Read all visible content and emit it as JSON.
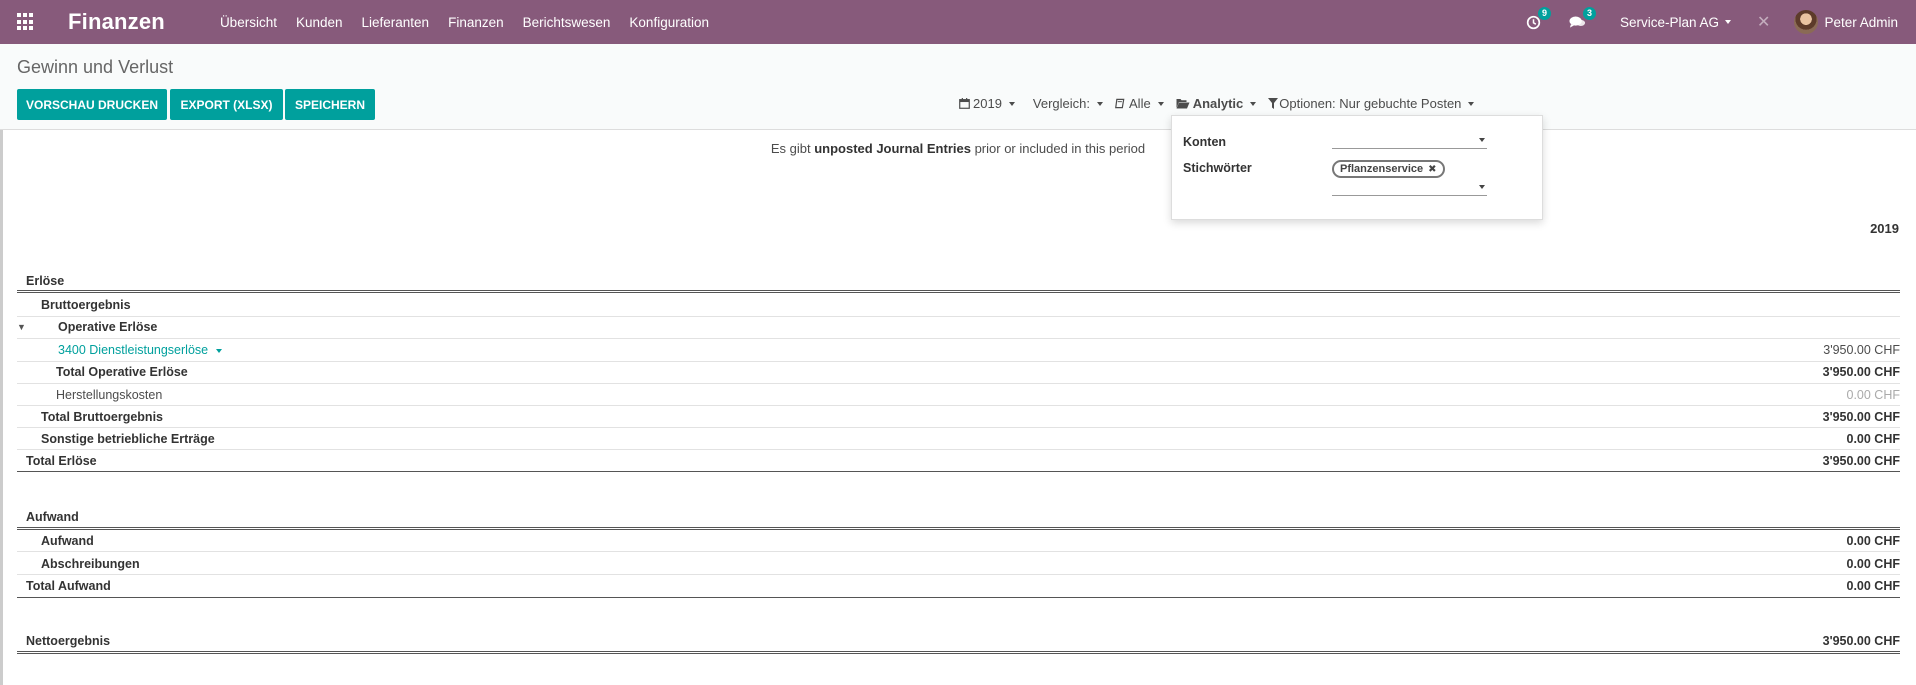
{
  "navbar": {
    "brand": "Finanzen",
    "menu": [
      "Übersicht",
      "Kunden",
      "Lieferanten",
      "Finanzen",
      "Berichtswesen",
      "Konfiguration"
    ],
    "activity_count": "9",
    "message_count": "3",
    "company": "Service-Plan AG",
    "user": "Peter Admin",
    "color": "#875a7b"
  },
  "control": {
    "title": "Gewinn und Verlust",
    "buttons": {
      "print": "VORSCHAU DRUCKEN",
      "export": "EXPORT (XLSX)",
      "save": "SPEICHERN"
    },
    "filters": {
      "date": "2019",
      "comparison": "Vergleich:",
      "journals": "Alle",
      "analytic": "Analytic",
      "options": "Optionen: Nur gebuchte Posten"
    },
    "accent": "#00a09d"
  },
  "notice": {
    "prefix": "Es gibt ",
    "strong": "unposted Journal Entries",
    "suffix": " prior or included in this period"
  },
  "analytic_dropdown": {
    "accounts_label": "Konten",
    "tags_label": "Stichwörter",
    "selected_tag": "Pflanzenservice"
  },
  "report": {
    "column_header": "2019",
    "rows": {
      "erloese": "Erlöse",
      "brutto": "Bruttoergebnis",
      "operative": "Operative Erlöse",
      "account_3400": "3400 Dienstleistungserlöse",
      "account_3400_value": "3'950.00 CHF",
      "total_operative": "Total Operative Erlöse",
      "total_operative_value": "3'950.00 CHF",
      "herstellung": "Herstellungskosten",
      "herstellung_value": "0.00 CHF",
      "total_brutto": "Total Bruttoergebnis",
      "total_brutto_value": "3'950.00 CHF",
      "sonstige": "Sonstige betriebliche Erträge",
      "sonstige_value": "0.00 CHF",
      "total_erloese": "Total Erlöse",
      "total_erloese_value": "3'950.00 CHF",
      "aufwand_head": "Aufwand",
      "aufwand": "Aufwand",
      "aufwand_value": "0.00 CHF",
      "abschreibungen": "Abschreibungen",
      "abschreibungen_value": "0.00 CHF",
      "total_aufwand": "Total Aufwand",
      "total_aufwand_value": "0.00 CHF",
      "netto": "Nettoergebnis",
      "netto_value": "3'950.00 CHF"
    }
  }
}
